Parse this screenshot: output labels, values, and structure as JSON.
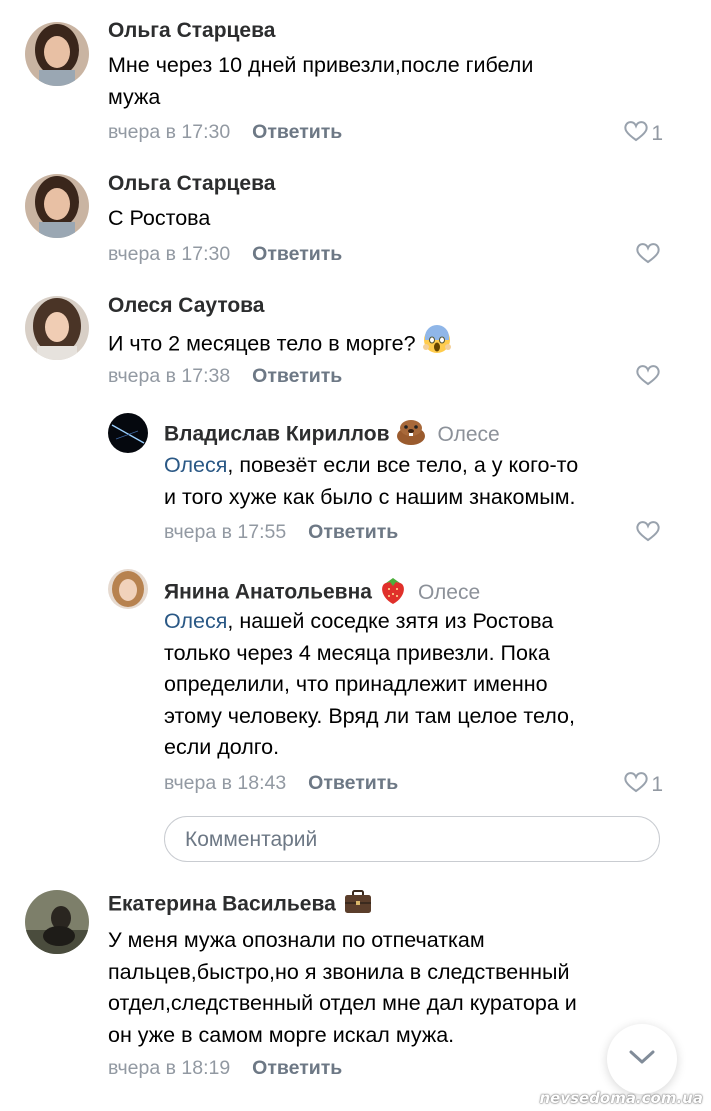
{
  "comments": [
    {
      "author": "Ольга Старцева",
      "text_lines": [
        "Мне через 10 дней привезли,после гибели",
        "мужа"
      ],
      "time": "вчера в 17:30",
      "reply_label": "Ответить",
      "likes": "1"
    },
    {
      "author": "Ольга Старцева",
      "text_lines": [
        "С Ростова"
      ],
      "time": "вчера в 17:30",
      "reply_label": "Ответить",
      "likes": ""
    },
    {
      "author": "Олеся Саутова",
      "text_lines": [
        "И что 2 месяцев тело в морге?"
      ],
      "emoji": "scream-emoji",
      "time": "вчера в 17:38",
      "reply_label": "Ответить",
      "likes": ""
    },
    {
      "author": "Владислав Кириллов",
      "badge": "beaver-emoji",
      "reply_to": "Олесе",
      "mention": "Олеся",
      "text_lines": [
        ", повезёт если все тело, а у кого-то",
        "и того хуже как было с нашим знакомым."
      ],
      "time": "вчера в 17:55",
      "reply_label": "Ответить",
      "likes": ""
    },
    {
      "author": "Янина Анатольевна",
      "badge": "strawberry-emoji",
      "reply_to": "Олесе",
      "mention": "Олеся",
      "text_lines": [
        ", нашей соседке зятя из Ростова",
        "только через 4 месяца привезли. Пока",
        "определили, что принадлежит именно",
        "этому человеку. Вряд ли там целое тело,",
        "если долго."
      ],
      "time": "вчера в 18:43",
      "reply_label": "Ответить",
      "likes": "1"
    },
    {
      "author": "Екатерина Васильева",
      "badge": "briefcase-emoji",
      "text_lines": [
        "У меня мужа опознали по отпечаткам",
        "пальцев,быстро,но я звонила в следственный",
        "отдел,следственный отдел мне дал куратора и",
        "он уже в самом морге искал мужа."
      ],
      "time": "вчера в 18:19",
      "reply_label": "Ответить",
      "likes": ""
    }
  ],
  "comment_input": {
    "placeholder": "Комментарий"
  },
  "watermark": "nevsedoma.com.ua",
  "colors": {
    "link": "#2a5885",
    "meta": "#9299a2",
    "action": "#6d7885"
  }
}
